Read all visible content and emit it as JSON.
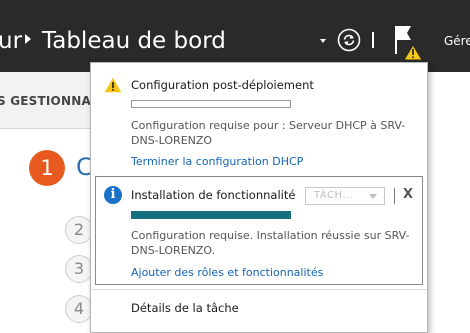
{
  "header": {
    "breadcrumb_prev": "ur",
    "title": "Tableau de bord",
    "manage_label": "Gére"
  },
  "background": {
    "nav_label": "S GESTIONNA",
    "steps": [
      "1",
      "2",
      "3",
      "4"
    ],
    "step1_text": "C"
  },
  "notifications": {
    "item1": {
      "title": "Configuration post-déploiement",
      "description": "Configuration requise pour : Serveur DHCP à SRV-DNS-LORENZO",
      "link": "Terminer la configuration DHCP",
      "progress": 0
    },
    "item2": {
      "title": "Installation de fonctionnalité",
      "task_dropdown": "TÂCH...",
      "close": "X",
      "description": "Configuration requise. Installation réussie sur SRV-DNS-LORENZO.",
      "link": "Ajouter des rôles et fonctionnalités",
      "progress": 1
    },
    "task_details": "Détails de la tâche"
  },
  "colors": {
    "header_bg": "#2a2a2a",
    "progress": "#14707e",
    "link": "#1565b3",
    "warning": "#f5c518",
    "info": "#1a72c8",
    "step_active": "#e8591f"
  }
}
